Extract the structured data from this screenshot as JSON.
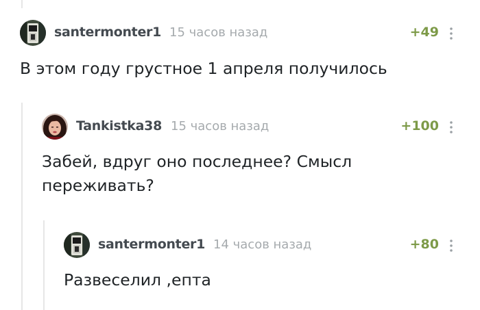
{
  "comments": [
    {
      "author": "santermonter1",
      "time": "15 часов назад",
      "rating": "+49",
      "text": "В этом году грустное 1 апреля получилось"
    },
    {
      "author": "Tankistka38",
      "time": "15 часов назад",
      "rating": "+100",
      "text": "Забей, вдруг оно последнее? Смысл переживать?"
    },
    {
      "author": "santermonter1",
      "time": "14 часов назад",
      "rating": "+80",
      "text": "Развеселил ,епта"
    }
  ],
  "colors": {
    "rating": "#7d9a48",
    "author": "#444a50",
    "time": "#a5aaad",
    "text": "#1f2326",
    "thread_line": "#e6e6e6"
  },
  "icons": {
    "avatar_1": "dark-cabinet-avatar",
    "avatar_2": "girl-portrait-avatar",
    "avatar_3": "dark-cabinet-avatar",
    "more": "vertical-ellipsis-icon"
  }
}
